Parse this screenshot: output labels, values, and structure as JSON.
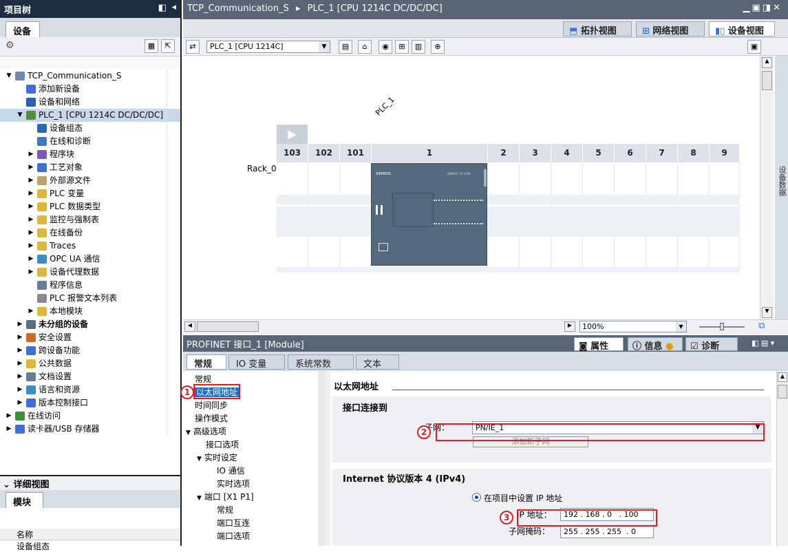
{
  "left_panel": {
    "title": "项目树",
    "tab": "设备",
    "tree": [
      {
        "label": "TCP_Communication_S",
        "expanded": "▼",
        "icon": "project-icon",
        "color": "#6f8ab0"
      },
      {
        "label": "添加新设备",
        "icon": "add-device-icon",
        "color": "#3d6fd6"
      },
      {
        "label": "设备和网络",
        "icon": "network-icon",
        "color": "#2c5fb0"
      },
      {
        "label": "PLC_1 [CPU 1214C DC/DC/DC]",
        "expanded": "▼",
        "icon": "plc-icon",
        "color": "#4d8f3a"
      },
      {
        "label": "设备组态",
        "icon": "device-config-icon",
        "color": "#2a6ab8"
      },
      {
        "label": "在线和诊断",
        "icon": "online-diag-icon",
        "color": "#3b78c7"
      },
      {
        "label": "程序块",
        "expanded": "▶",
        "icon": "program-blocks-icon",
        "color": "#7a5bb5"
      },
      {
        "label": "工艺对象",
        "expanded": "▶",
        "icon": "tech-objects-icon",
        "color": "#3d6fd6"
      },
      {
        "label": "外部源文件",
        "expanded": "▶",
        "icon": "source-files-icon",
        "color": "#b8a36a"
      },
      {
        "label": "PLC 变量",
        "expanded": "▶",
        "icon": "plc-tags-icon",
        "color": "#e0b63a"
      },
      {
        "label": "PLC 数据类型",
        "expanded": "▶",
        "icon": "plc-datatypes-icon",
        "color": "#e0b63a"
      },
      {
        "label": "监控与强制表",
        "expanded": "▶",
        "icon": "watch-table-icon",
        "color": "#e0b63a"
      },
      {
        "label": "在线备份",
        "expanded": "▶",
        "icon": "online-backup-icon",
        "color": "#e0b63a"
      },
      {
        "label": "Traces",
        "expanded": "▶",
        "icon": "traces-icon",
        "color": "#e0b63a"
      },
      {
        "label": "OPC UA 通信",
        "expanded": "▶",
        "icon": "opcua-icon",
        "color": "#3c8dc4"
      },
      {
        "label": "设备代理数据",
        "expanded": "▶",
        "icon": "proxy-data-icon",
        "color": "#e0b63a"
      },
      {
        "label": "程序信息",
        "icon": "program-info-icon",
        "color": "#6a7d97"
      },
      {
        "label": "PLC 报警文本列表",
        "icon": "alarm-text-icon",
        "color": "#8a8a8a"
      },
      {
        "label": "本地模块",
        "expanded": "▶",
        "icon": "local-modules-icon",
        "color": "#e0b63a"
      },
      {
        "label": "未分组的设备",
        "expanded": "▶",
        "icon": "ungrouped-devices-icon",
        "color": "#5a6e8a",
        "bold": true
      },
      {
        "label": "安全设置",
        "expanded": "▶",
        "icon": "security-icon",
        "color": "#d06a2a"
      },
      {
        "label": "跨设备功能",
        "expanded": "▶",
        "icon": "cross-device-icon",
        "color": "#3d6fd6"
      },
      {
        "label": "公共数据",
        "expanded": "▶",
        "icon": "common-data-icon",
        "color": "#e0b63a"
      },
      {
        "label": "文档设置",
        "expanded": "▶",
        "icon": "doc-settings-icon",
        "color": "#6a7d97"
      },
      {
        "label": "语言和资源",
        "expanded": "▶",
        "icon": "language-icon",
        "color": "#3c8dc4"
      },
      {
        "label": "版本控制接口",
        "expanded": "▶",
        "icon": "version-control-icon",
        "color": "#3d6fd6"
      },
      {
        "label": "在线访问",
        "expanded": "▶",
        "icon": "online-access-icon",
        "color": "#3d8f3a"
      },
      {
        "label": "读卡器/USB 存储器",
        "expanded": "▶",
        "icon": "card-reader-icon",
        "color": "#3d6fd6"
      }
    ],
    "detail_view": {
      "title": "详细视图",
      "tab": "模块",
      "column": "名称",
      "row": "设备组态"
    }
  },
  "editor": {
    "title_parts": [
      "TCP_Communication_S",
      "PLC_1 [CPU 1214C DC/DC/DC]"
    ],
    "view_tabs": [
      "拓扑视图",
      "网络视图",
      "设备视图"
    ],
    "device_select": "PLC_1 [CPU 1214C]",
    "plc_label": "PLC_1",
    "rack_label": "Rack_0",
    "slots": [
      "103",
      "102",
      "101",
      "1",
      "2",
      "3",
      "4",
      "5",
      "6",
      "7",
      "8",
      "9"
    ],
    "zoom": "100%",
    "side_tab": "设备数据",
    "cpu_brand": "SIEMENS",
    "cpu_model": "SIMATIC S7-1200"
  },
  "properties": {
    "title": "PROFINET 接口_1 [Module]",
    "panel_tabs": [
      "属性",
      "信息",
      "诊断"
    ],
    "sub_tabs": [
      "常规",
      "IO 变量",
      "系统常数",
      "文本"
    ],
    "nav": [
      {
        "label": "常规",
        "indent": 0
      },
      {
        "label": "以太网地址",
        "indent": 0,
        "selected": true,
        "badge": "1"
      },
      {
        "label": "时间同步",
        "indent": 0
      },
      {
        "label": "操作模式",
        "indent": 0
      },
      {
        "label": "高级选项",
        "indent": 0,
        "arrow": "▼"
      },
      {
        "label": "接口选项",
        "indent": 1
      },
      {
        "label": "实时设定",
        "indent": 1,
        "arrow": "▼"
      },
      {
        "label": "IO 通信",
        "indent": 2
      },
      {
        "label": "实时选项",
        "indent": 2
      },
      {
        "label": "端口 [X1 P1]",
        "indent": 1,
        "arrow": "▼"
      },
      {
        "label": "常规",
        "indent": 2
      },
      {
        "label": "端口互连",
        "indent": 2
      },
      {
        "label": "端口选项",
        "indent": 2
      }
    ],
    "content": {
      "heading": "以太网地址",
      "section1": "接口连接到",
      "subnet_label": "子网：",
      "subnet_value": "PN/IE_1",
      "add_subnet_button": "添加新子网",
      "badge2": "2",
      "section2": "Internet 协议版本 4 (IPv4)",
      "radio_label": "在项目中设置 IP 地址",
      "ip_label": "IP 地址：",
      "ip_value": [
        "192",
        "168",
        "0",
        "100"
      ],
      "mask_label": "子网掩码：",
      "mask_value": [
        "255",
        "255",
        "255",
        "0"
      ],
      "badge3": "3"
    }
  }
}
